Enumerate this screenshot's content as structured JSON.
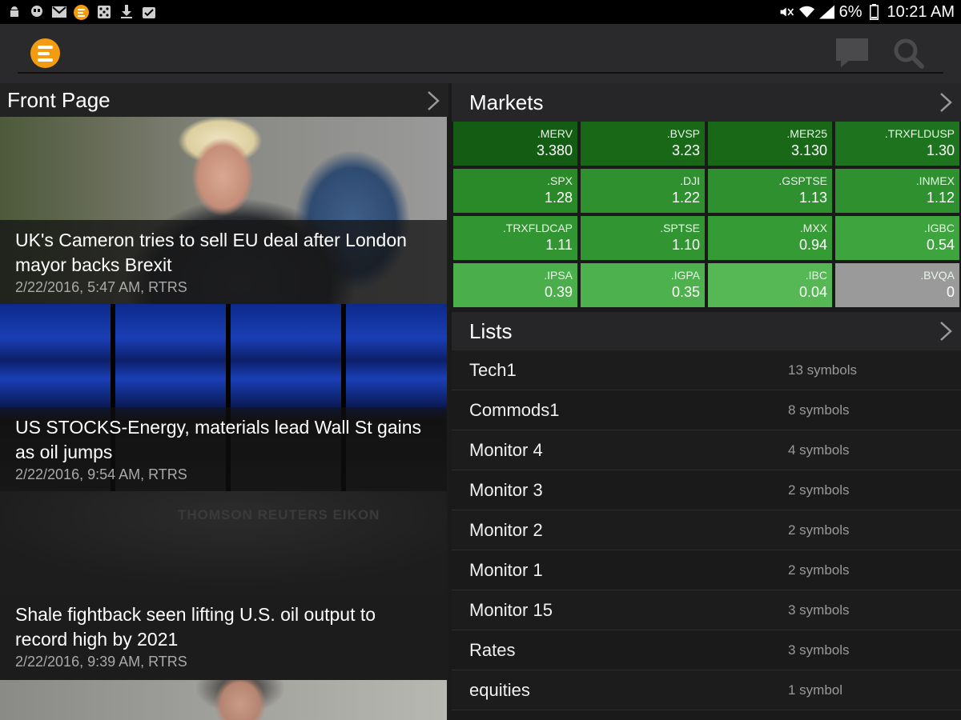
{
  "status": {
    "battery": "6%",
    "time": "10:21 AM"
  },
  "news": {
    "section_title": "Front Page",
    "items": [
      {
        "headline": "UK's Cameron tries to sell EU deal after London mayor backs Brexit",
        "meta": "2/22/2016, 5:47 AM, RTRS"
      },
      {
        "headline": "US STOCKS-Energy, materials lead Wall St gains as oil jumps",
        "meta": "2/22/2016, 9:54 AM, RTRS"
      },
      {
        "headline": "Shale fightback seen lifting U.S. oil output to record high by 2021",
        "meta": "2/22/2016, 9:39 AM, RTRS"
      }
    ],
    "watermark": "THOMSON REUTERS EIKON"
  },
  "markets": {
    "title": "Markets",
    "tiles": [
      {
        "symbol": ".MERV",
        "value": "3.380",
        "color": "#145c14"
      },
      {
        "symbol": ".BVSP",
        "value": "3.23",
        "color": "#186818"
      },
      {
        "symbol": ".MER25",
        "value": "3.130",
        "color": "#186818"
      },
      {
        "symbol": ".TRXFLDUSP",
        "value": "1.30",
        "color": "#1e741e"
      },
      {
        "symbol": ".SPX",
        "value": "1.28",
        "color": "#2a8a2a"
      },
      {
        "symbol": ".DJI",
        "value": "1.22",
        "color": "#2e902e"
      },
      {
        "symbol": ".GSPTSE",
        "value": "1.13",
        "color": "#2e902e"
      },
      {
        "symbol": ".INMEX",
        "value": "1.12",
        "color": "#2e902e"
      },
      {
        "symbol": ".TRXFLDCAP",
        "value": "1.11",
        "color": "#319631"
      },
      {
        "symbol": ".SPTSE",
        "value": "1.10",
        "color": "#319631"
      },
      {
        "symbol": ".MXX",
        "value": "0.94",
        "color": "#359c35"
      },
      {
        "symbol": ".IGBC",
        "value": "0.54",
        "color": "#3ea43e"
      },
      {
        "symbol": ".IPSA",
        "value": "0.39",
        "color": "#4aae4a"
      },
      {
        "symbol": ".IGPA",
        "value": "0.35",
        "color": "#4db24d"
      },
      {
        "symbol": ".IBC",
        "value": "0.04",
        "color": "#55b855"
      },
      {
        "symbol": ".BVQA",
        "value": "0",
        "color": "#9a9a9a"
      }
    ]
  },
  "lists": {
    "title": "Lists",
    "items": [
      {
        "name": "Tech1",
        "count": "13 symbols"
      },
      {
        "name": "Commods1",
        "count": "8 symbols"
      },
      {
        "name": "Monitor 4",
        "count": "4 symbols"
      },
      {
        "name": "Monitor 3",
        "count": "2 symbols"
      },
      {
        "name": "Monitor 2",
        "count": "2 symbols"
      },
      {
        "name": "Monitor 1",
        "count": "2 symbols"
      },
      {
        "name": "Monitor 15",
        "count": "3 symbols"
      },
      {
        "name": "Rates",
        "count": "3 symbols"
      },
      {
        "name": "equities",
        "count": "1 symbol"
      }
    ]
  }
}
